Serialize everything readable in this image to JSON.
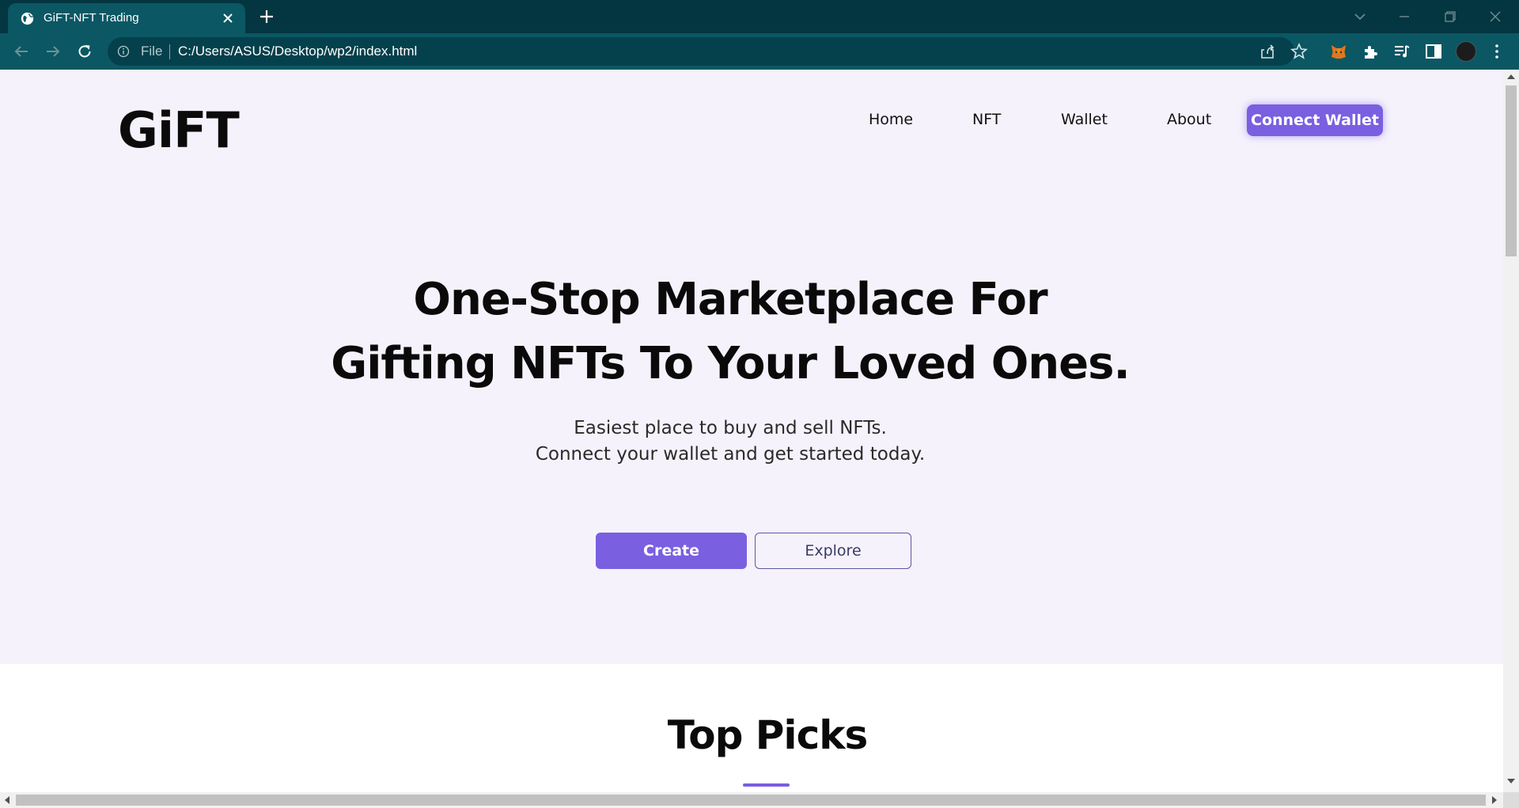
{
  "browser": {
    "tab_title": "GiFT-NFT Trading",
    "address_scheme": "File",
    "address_url": "C:/Users/ASUS/Desktop/wp2/index.html",
    "icons": [
      "globe-icon",
      "close-icon",
      "plus-icon",
      "chevron-down-icon",
      "minimize-icon",
      "restore-icon",
      "close-window-icon",
      "back-icon",
      "forward-icon",
      "reload-icon",
      "info-icon",
      "share-icon",
      "star-icon",
      "fox-extension-icon",
      "puzzle-icon",
      "media-queue-icon",
      "side-panel-icon",
      "avatar",
      "more-icon"
    ]
  },
  "site": {
    "logo": "GiFT",
    "nav": {
      "home": "Home",
      "nft": "NFT",
      "wallet": "Wallet",
      "about": "About",
      "connect": "Connect Wallet"
    },
    "hero": {
      "headline_line1": "One-Stop Marketplace For",
      "headline_line2": "Gifting NFTs To Your Loved Ones.",
      "sub_line1": "Easiest place to buy and sell NFTs.",
      "sub_line2": "Connect your wallet and get started today.",
      "create_label": "Create",
      "explore_label": "Explore"
    },
    "section_title": "Top Picks"
  },
  "colors": {
    "chrome_dark": "#033640",
    "chrome_teal": "#0b5764",
    "hero_bg": "#f5f2fc",
    "accent": "#7a5fe0"
  }
}
